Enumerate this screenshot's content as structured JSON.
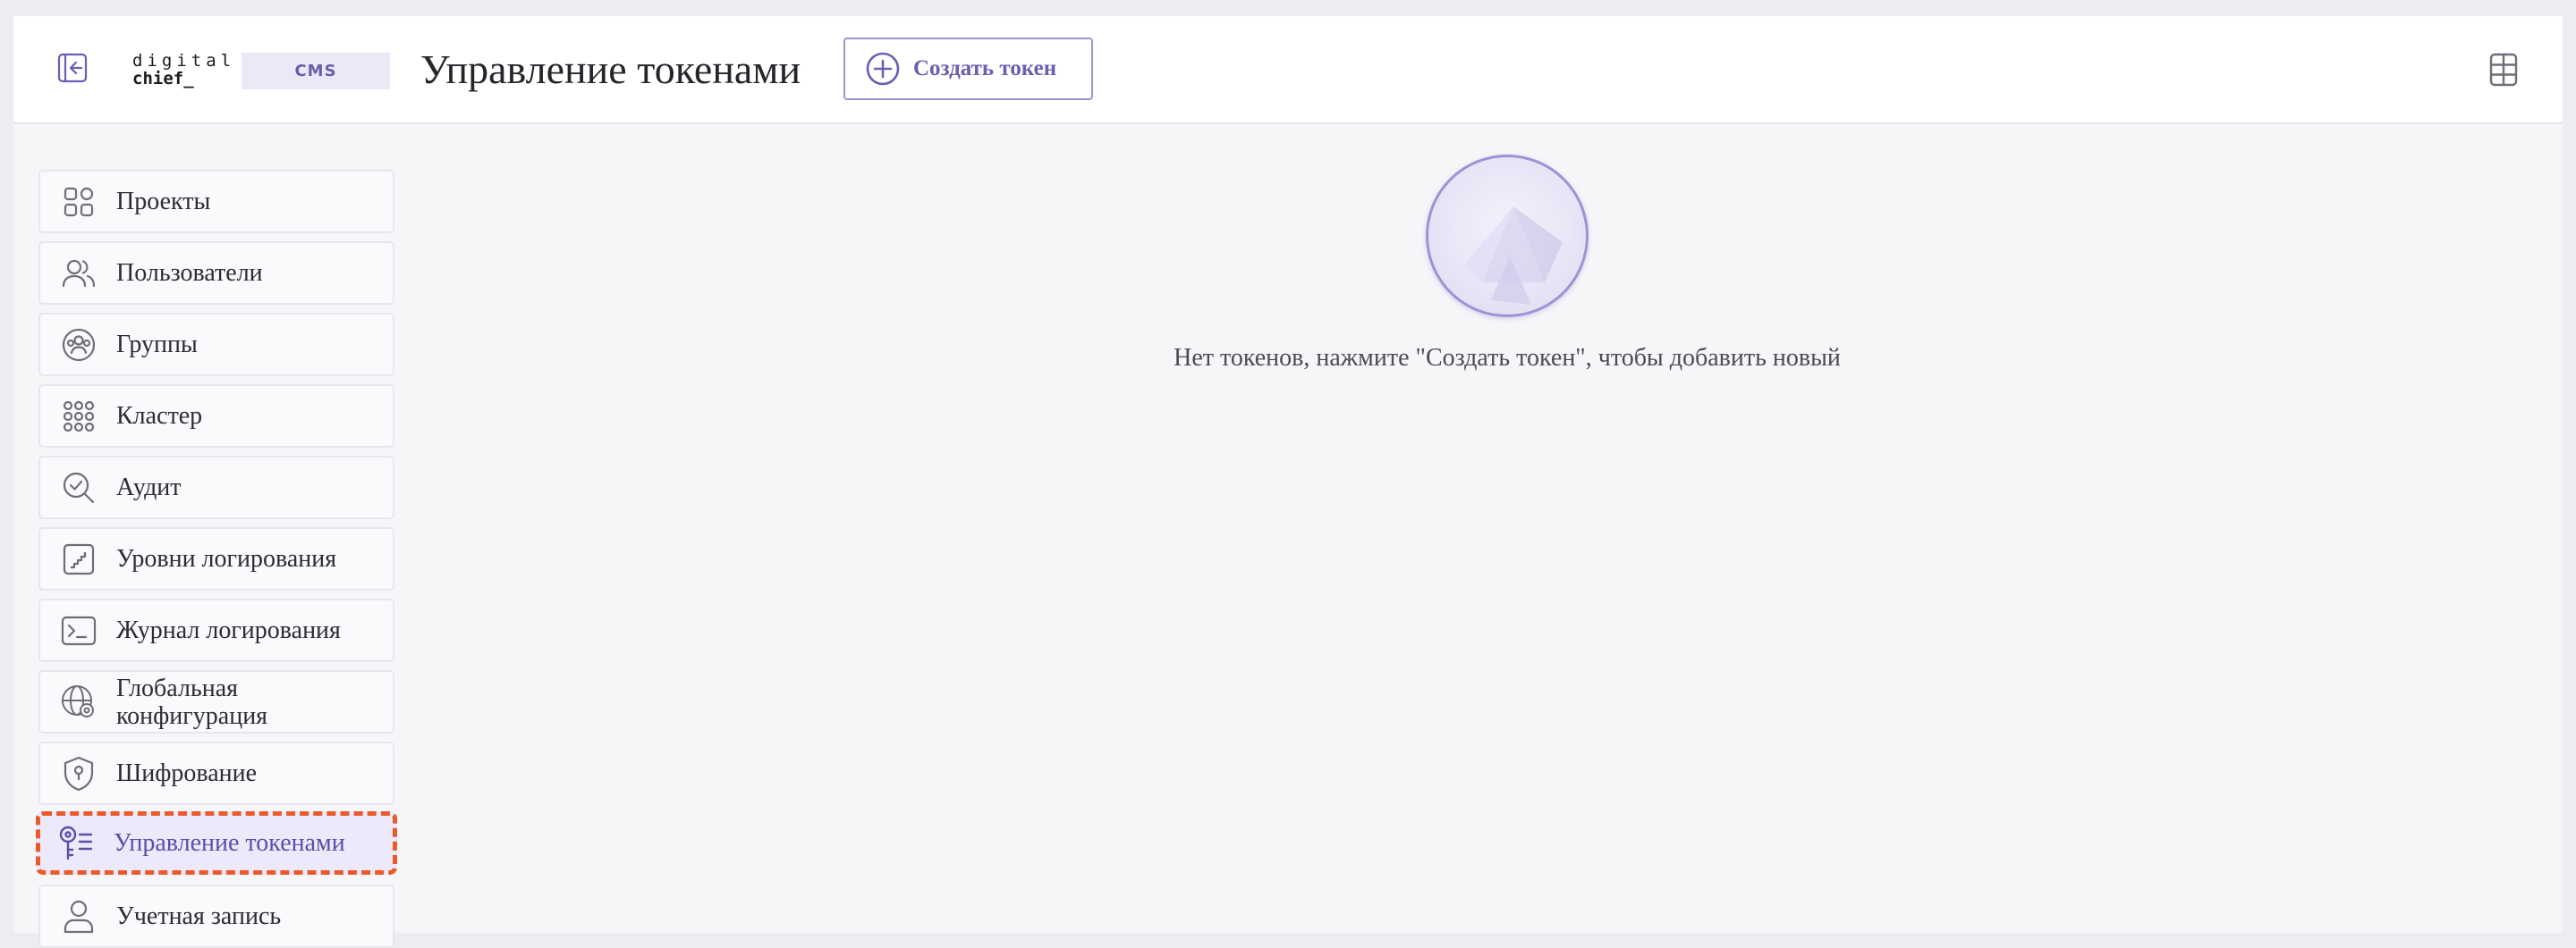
{
  "header": {
    "logo_line1": "digital",
    "logo_line2": "chief_",
    "cms_badge": "CMS",
    "title": "Управление токенами",
    "create_button_label": "Создать токен"
  },
  "sidebar": {
    "items": [
      {
        "label": "Проекты",
        "icon": "projects-icon"
      },
      {
        "label": "Пользователи",
        "icon": "users-icon"
      },
      {
        "label": "Группы",
        "icon": "groups-icon"
      },
      {
        "label": "Кластер",
        "icon": "cluster-icon"
      },
      {
        "label": "Аудит",
        "icon": "audit-icon"
      },
      {
        "label": "Уровни логирования",
        "icon": "log-levels-icon"
      },
      {
        "label": "Журнал логирования",
        "icon": "terminal-icon"
      },
      {
        "label": "Глобальная конфигурация",
        "icon": "global-config-icon"
      },
      {
        "label": "Шифрование",
        "icon": "shield-icon"
      },
      {
        "label": "Управление токенами",
        "icon": "token-key-icon",
        "active": true
      },
      {
        "label": "Учетная запись",
        "icon": "account-icon"
      }
    ]
  },
  "main": {
    "empty_message": "Нет токенов, нажмите \"Создать токен\", чтобы добавить новый"
  },
  "colors": {
    "accent": "#6a5fb0",
    "highlight_border": "#ea5a2c",
    "active_bg": "#ece9fa"
  }
}
